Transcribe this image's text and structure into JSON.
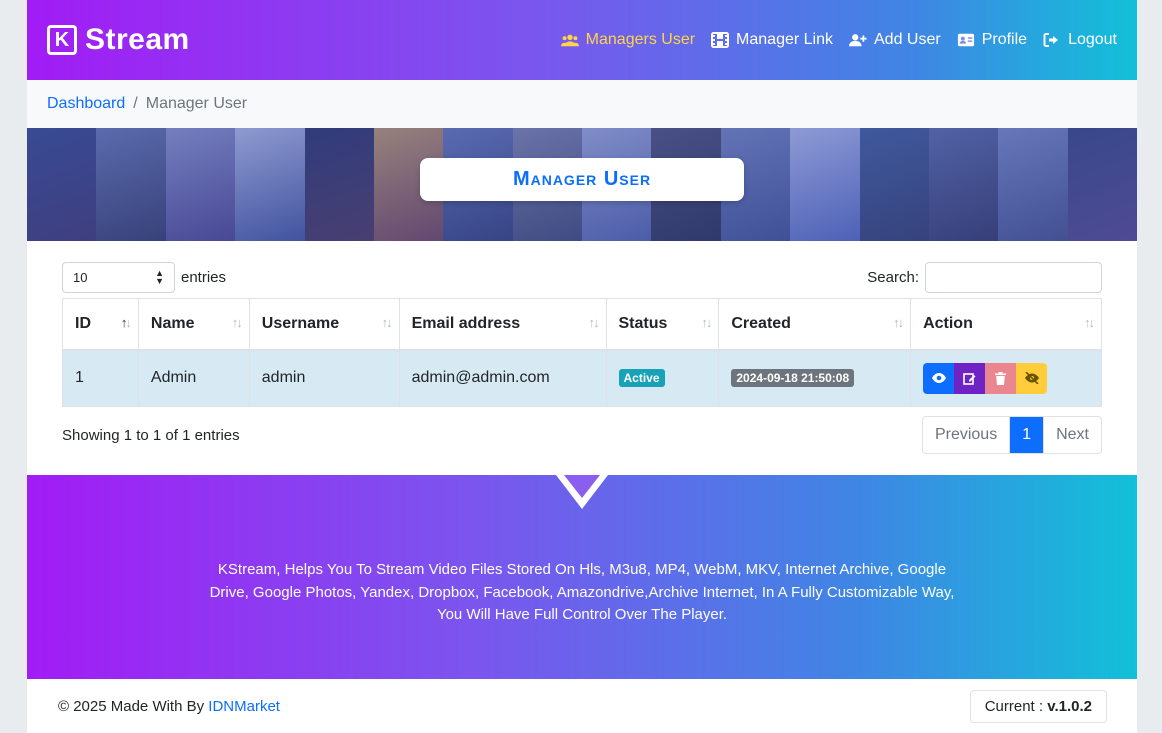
{
  "brand": {
    "name": "Stream",
    "logo_letter": "K"
  },
  "nav": [
    {
      "label": "Managers User",
      "icon": "users-icon",
      "active": true
    },
    {
      "label": "Manager Link",
      "icon": "film-icon",
      "active": false
    },
    {
      "label": "Add User",
      "icon": "user-plus-icon",
      "active": false
    },
    {
      "label": "Profile",
      "icon": "id-card-icon",
      "active": false
    },
    {
      "label": "Logout",
      "icon": "sign-out-icon",
      "active": false
    }
  ],
  "breadcrumb": {
    "home": "Dashboard",
    "separator": "/",
    "current": "Manager User"
  },
  "banner": {
    "title": "Manager User"
  },
  "table_controls": {
    "length_value": "10",
    "length_suffix": "entries",
    "search_label": "Search:",
    "search_value": ""
  },
  "table": {
    "columns": [
      "ID",
      "Name",
      "Username",
      "Email address",
      "Status",
      "Created",
      "Action"
    ],
    "rows": [
      {
        "id": "1",
        "name": "Admin",
        "username": "admin",
        "email": "admin@admin.com",
        "status": "Active",
        "created": "2024-09-18 21:50:08"
      }
    ]
  },
  "table_info": "Showing 1 to 1 of 1 entries",
  "pagination": {
    "prev": "Previous",
    "page": "1",
    "next": "Next"
  },
  "promo_text": "KStream, Helps You To Stream Video Files Stored On Hls, M3u8, MP4, WebM, MKV, Internet Archive, Google Drive, Google Photos, Yandex, Dropbox, Facebook, Amazondrive,Archive Internet, In A Fully Customizable Way, You Will Have Full Control Over The Player.",
  "footer": {
    "copyright": "© 2025 Made With By",
    "link": "IDNMarket",
    "version_label": "Current :",
    "version_value": "v.1.0.2"
  },
  "colors": {
    "primary": "#0d6efd",
    "active_nav": "#ffd447",
    "gradient_start": "#a21cf5",
    "gradient_end": "#12c0d8"
  }
}
